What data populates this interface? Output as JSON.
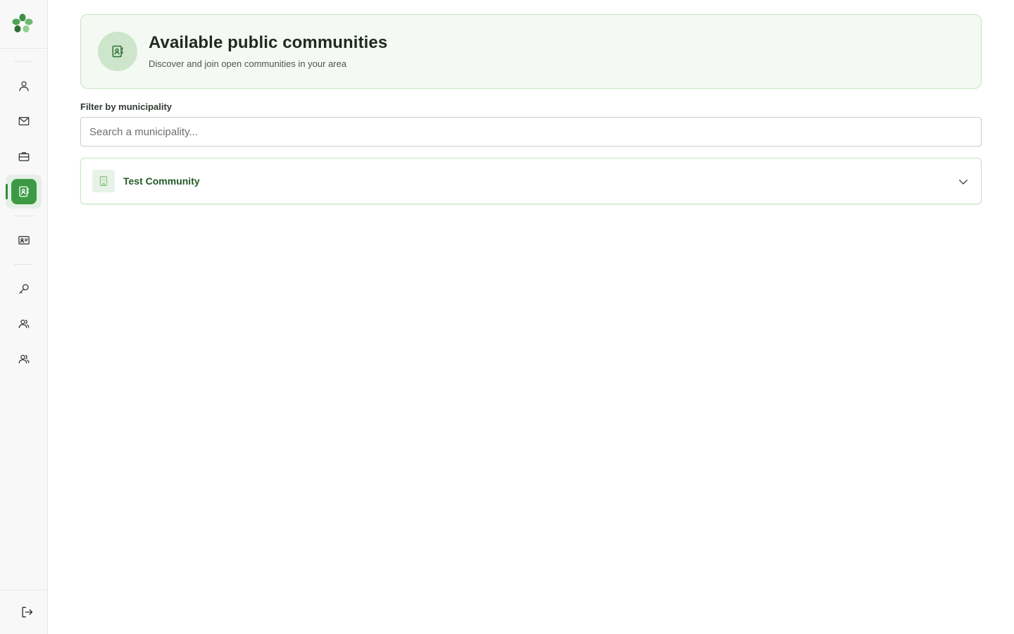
{
  "header": {
    "title": "Available public communities",
    "subtitle": "Discover and join open communities in your area"
  },
  "filter": {
    "label": "Filter by municipality",
    "placeholder": "Search a municipality..."
  },
  "communities": [
    {
      "name": "Test Community",
      "icon": "building-icon"
    }
  ],
  "sidebar": {
    "items": [
      {
        "icon": "user-icon",
        "active": false
      },
      {
        "icon": "mail-icon",
        "active": false
      },
      {
        "icon": "briefcase-icon",
        "active": false
      },
      {
        "icon": "contact-book-icon",
        "active": true
      },
      {
        "icon": "id-card-icon",
        "active": false
      },
      {
        "icon": "key-icon",
        "active": false
      },
      {
        "icon": "users-icon",
        "active": false
      },
      {
        "icon": "users-icon",
        "active": false
      }
    ],
    "logout_icon": "logout-icon"
  },
  "colors": {
    "accent": "#3c9a45",
    "header_bg": "#f4f9f3",
    "header_border": "#c6e3c3",
    "community_name": "#225a27"
  }
}
